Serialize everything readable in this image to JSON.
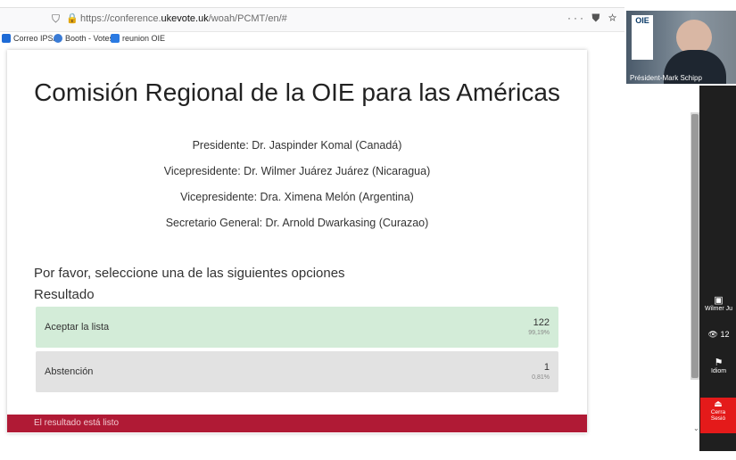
{
  "browser": {
    "url_prefix": "https://conference.",
    "url_domain": "ukevote.uk",
    "url_suffix": "/woah/PCMT/en/#",
    "icons": {
      "tracking": "shield-icon",
      "secure": "lock-icon",
      "menu": "more-icon",
      "pocket": "pocket-icon",
      "bookmark": "star-icon"
    },
    "bookmarks": [
      {
        "label": "Correo IPSA",
        "icon_color": "#1e6bd6"
      },
      {
        "label": "Booth - Votes",
        "icon_color": "#3a7bd5"
      },
      {
        "label": "reunion OIE",
        "icon_color": "#2a7ae2"
      }
    ]
  },
  "page": {
    "title": "Comisión Regional de la OIE para las Américas",
    "officers": [
      "Presidente: Dr. Jaspinder Komal (Canadá)",
      "Vicepresidente: Dr. Wilmer Juárez Juárez (Nicaragua)",
      "Vicepresidente: Dra. Ximena Melón (Argentina)",
      "Secretario General: Dr. Arnold Dwarkasing (Curazao)"
    ],
    "prompt": "Por favor, seleccione una de las siguientes opciones",
    "result_label": "Resultado",
    "options": [
      {
        "label": "Aceptar la lista",
        "count": "122",
        "percent": "99,19%",
        "color": "#d3ecd8"
      },
      {
        "label": "Abstención",
        "count": "1",
        "percent": "0,81%",
        "color": "#e2e2e2"
      }
    ],
    "banner": "El resultado está listo",
    "banner_color": "#b01a35"
  },
  "video": {
    "logo_text": "OIE",
    "speaker_name": "Président-Mark Schipp"
  },
  "sidepanel": {
    "participant": "Wilmer Ju",
    "viewers": "12",
    "language": "Idiom",
    "close_label_1": "Cerra",
    "close_label_2": "Sesió",
    "close_color": "#e41a1a"
  }
}
